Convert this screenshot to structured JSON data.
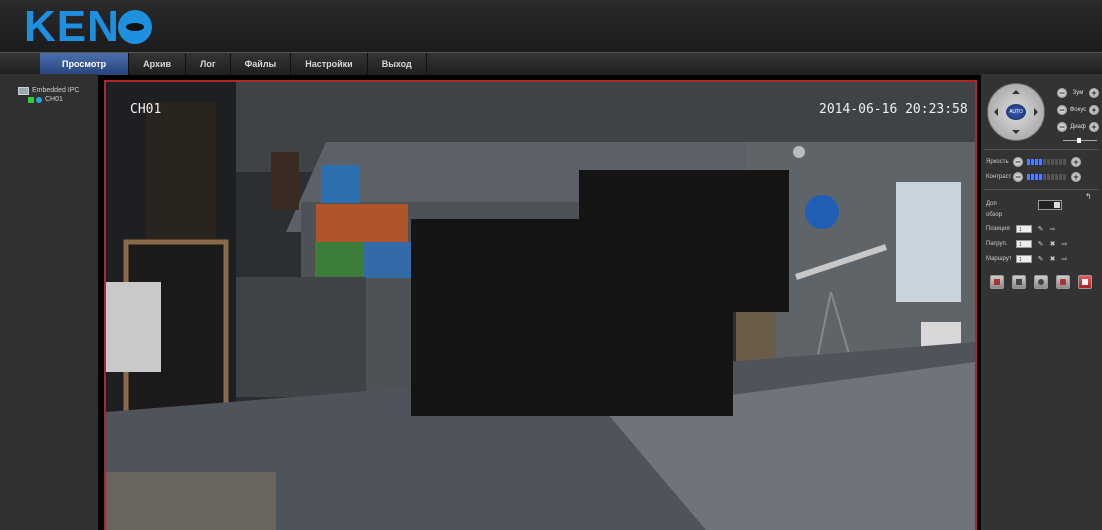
{
  "app": {
    "logo_text": "KEN",
    "logo_icon": "eye-logo-icon",
    "brand_color": "#1f8fe0"
  },
  "nav": {
    "active_color": "#2f4f8c",
    "items": [
      {
        "label": "Просмотр",
        "active": true
      },
      {
        "label": "Архив"
      },
      {
        "label": "Лог"
      },
      {
        "label": "Файлы"
      },
      {
        "label": "Настройки"
      },
      {
        "label": "Выход"
      }
    ]
  },
  "device_tree": {
    "device_label": "Embedded IPC",
    "channel_label": "CH01"
  },
  "video": {
    "channel_osd": "CH01",
    "timestamp_osd": "2014-06-16 20:23:58",
    "border_color": "#b02626"
  },
  "ptz": {
    "auto_label": "AUTO",
    "zoom_label": "Зум",
    "focus_label": "Фокус",
    "iris_label": "Диаф",
    "minus_icon": "minus-icon",
    "plus_icon": "plus-icon"
  },
  "image_adjust": {
    "brightness_label": "Яркость",
    "brightness_level": 0.4,
    "contrast_label": "Контраст",
    "contrast_level": 0.4
  },
  "extra": {
    "dop_label": "Доп",
    "obzor_label": "обзор",
    "position_label": "Позиция",
    "patrol_label": "Патруп.",
    "route_label": "Маршрут",
    "preset_value": "1"
  },
  "actions": [
    {
      "icon": "record-icon"
    },
    {
      "icon": "snapshot-icon"
    },
    {
      "icon": "audio-icon"
    },
    {
      "icon": "fullscreen-icon"
    },
    {
      "icon": "stop-icon"
    }
  ]
}
